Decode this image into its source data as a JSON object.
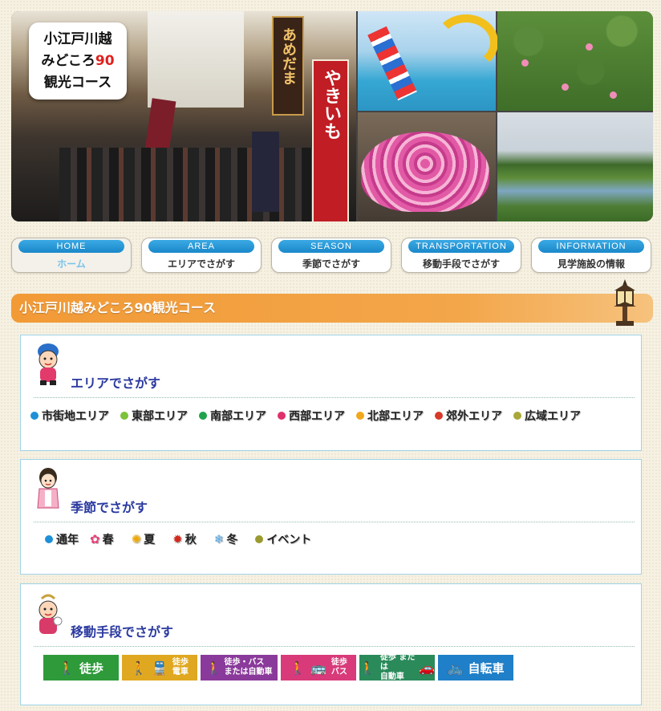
{
  "header": {
    "logo_line1": "小江戸川越",
    "logo_line2a": "みどころ",
    "logo_line2b": "90",
    "logo_line3": "観光コース",
    "sign_ame": "あめだま",
    "banner_red": "やきいも"
  },
  "nav": [
    {
      "en": "HOME",
      "jp": "ホーム"
    },
    {
      "en": "AREA",
      "jp": "エリアでさがす"
    },
    {
      "en": "SEASON",
      "jp": "季節でさがす"
    },
    {
      "en": "TRANSPORTATION",
      "jp": "移動手段でさがす"
    },
    {
      "en": "INFORMATION",
      "jp": "見学施設の情報"
    }
  ],
  "page_title": "小江戸川越みどころ90観光コース",
  "area": {
    "heading": "エリアでさがす",
    "items": [
      {
        "label": "市街地エリア",
        "color": "#1e90d8"
      },
      {
        "label": "東部エリア",
        "color": "#7cc23a"
      },
      {
        "label": "南部エリア",
        "color": "#1ea34a"
      },
      {
        "label": "西部エリア",
        "color": "#e0306a"
      },
      {
        "label": "北部エリア",
        "color": "#f0a81c"
      },
      {
        "label": "郊外エリア",
        "color": "#d83a2a"
      },
      {
        "label": "広域エリア",
        "color": "#a8a838"
      }
    ]
  },
  "season": {
    "heading": "季節でさがす",
    "items": [
      {
        "label": "通年",
        "icon": "●",
        "color": "#1e90d8"
      },
      {
        "label": "春",
        "icon": "✿",
        "color": "#e8407a"
      },
      {
        "label": "夏",
        "icon": "✺",
        "color": "#f0a800"
      },
      {
        "label": "秋",
        "icon": "✹",
        "color": "#d2281e"
      },
      {
        "label": "冬",
        "icon": "❄",
        "color": "#5aa8e0"
      },
      {
        "label": "イベント",
        "icon": "●",
        "color": "#9a9a30"
      }
    ]
  },
  "transport": {
    "heading": "移動手段でさがす",
    "buttons": [
      {
        "label": "徒歩",
        "color": "#2e9a3a"
      },
      {
        "label1": "徒歩",
        "label2": "電車",
        "color": "#e0a820"
      },
      {
        "label1": "徒歩・バス",
        "label2": "または自動車",
        "color": "#8a3a9a"
      },
      {
        "label1": "徒歩",
        "label2": "バス",
        "color": "#d83a7a"
      },
      {
        "label1": "徒歩 または",
        "label2": "自動車",
        "color": "#2a8a5a"
      },
      {
        "label": "自転車",
        "color": "#1f7fc8"
      }
    ]
  }
}
